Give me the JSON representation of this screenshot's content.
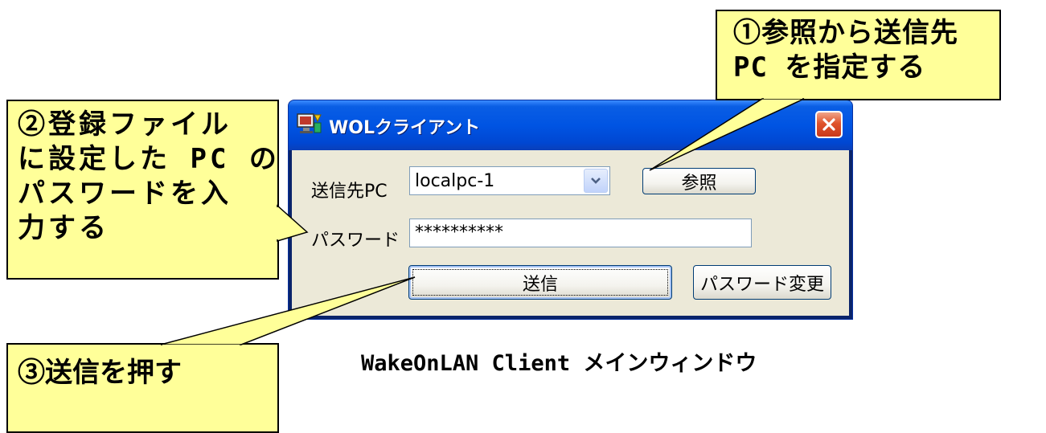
{
  "dialog": {
    "title": "WOLクライアント",
    "target_pc_label": "送信先PC",
    "target_pc_value": "localpc-1",
    "browse_button": "参照",
    "password_label": "パスワード",
    "password_value": "**********",
    "send_button": "送信",
    "change_password_button": "パスワード変更"
  },
  "callouts": {
    "step1": [
      "①参照から送信先",
      "PC を指定する"
    ],
    "step2": [
      "②登録ファイル",
      "に設定した PC の",
      "パスワードを入",
      "力する"
    ],
    "step3": [
      "③送信を押す"
    ]
  },
  "caption": "WakeOnLAN Client メインウィンドウ",
  "colors": {
    "callout_fill": "#ffff99",
    "titlebar": "#0054e3",
    "client_bg": "#ece9d8",
    "close_button": "#e0532b"
  }
}
